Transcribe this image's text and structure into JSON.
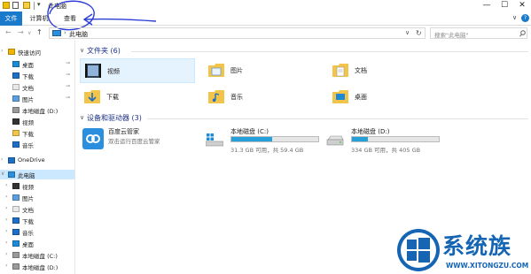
{
  "window": {
    "title": "此电脑",
    "quick_access_dropdown": "▾",
    "minimize": "—",
    "maximize": "☐",
    "close": "✕"
  },
  "ribbon": {
    "tabs": [
      "文件",
      "计算机",
      "查看"
    ],
    "expand": "∨",
    "help": "?"
  },
  "navigation": {
    "back": "←",
    "forward": "→",
    "recent": "∨",
    "up": "↑",
    "separator": "›",
    "address": "此电脑",
    "address_dropdown": "∨",
    "refresh": "↻",
    "search_placeholder": "搜索\"此电脑\"",
    "search_icon": "search-icon"
  },
  "sidebar": {
    "items": [
      {
        "label": "快速访问",
        "icon": "star-icon",
        "chevron": "›",
        "pinned": false
      },
      {
        "label": "桌面",
        "icon": "desktop-icon",
        "chevron": "",
        "pinned": true
      },
      {
        "label": "下载",
        "icon": "download-icon",
        "chevron": "",
        "pinned": true
      },
      {
        "label": "文档",
        "icon": "document-icon",
        "chevron": "",
        "pinned": true
      },
      {
        "label": "图片",
        "icon": "pictures-icon",
        "chevron": "",
        "pinned": true
      },
      {
        "label": "本地磁盘 (D:)",
        "icon": "drive-icon",
        "chevron": "",
        "pinned": false
      },
      {
        "label": "视频",
        "icon": "video-icon",
        "chevron": "",
        "pinned": false
      },
      {
        "label": "下载",
        "icon": "folder-icon",
        "chevron": "",
        "pinned": false
      },
      {
        "label": "音乐",
        "icon": "music-icon",
        "chevron": "",
        "pinned": false
      },
      {
        "label": "OneDrive",
        "icon": "onedrive-icon",
        "chevron": "›",
        "pinned": false
      },
      {
        "label": "此电脑",
        "icon": "computer-icon",
        "chevron": "∨",
        "pinned": false
      },
      {
        "label": "视频",
        "icon": "video-icon",
        "chevron": "›",
        "pinned": false
      },
      {
        "label": "图片",
        "icon": "pictures-icon",
        "chevron": "›",
        "pinned": false
      },
      {
        "label": "文档",
        "icon": "document-icon",
        "chevron": "›",
        "pinned": false
      },
      {
        "label": "下载",
        "icon": "download-icon",
        "chevron": "›",
        "pinned": false
      },
      {
        "label": "音乐",
        "icon": "music-icon",
        "chevron": "›",
        "pinned": false
      },
      {
        "label": "桌面",
        "icon": "desktop-icon",
        "chevron": "›",
        "pinned": false
      },
      {
        "label": "本地磁盘 (C:)",
        "icon": "drive-icon",
        "chevron": "›",
        "pinned": false
      },
      {
        "label": "本地磁盘 (D:)",
        "icon": "drive-icon",
        "chevron": "›",
        "pinned": false
      }
    ],
    "pin_glyph": "⊸"
  },
  "folders": {
    "heading": "文件夹 (6)",
    "chevron": "∨",
    "items": [
      "视频",
      "图片",
      "文档",
      "下载",
      "音乐",
      "桌面"
    ]
  },
  "devices": {
    "heading": "设备和驱动器 (3)",
    "chevron": "∨",
    "app": {
      "name": "百度云管家",
      "subtitle": "双击运行百度云管家"
    },
    "drives": [
      {
        "name": "本地磁盘 (C:)",
        "space": "31.3 GB 可用，共 59.4 GB",
        "used_fraction": 0.47
      },
      {
        "name": "本地磁盘 (D:)",
        "space": "334 GB 可用，共 405 GB",
        "used_fraction": 0.18
      }
    ]
  },
  "watermark": {
    "text": "系统族",
    "url": "WWW.XITONGZU.COM"
  },
  "colors": {
    "accent": "#1979ca",
    "selection": "#cce8ff",
    "drive_bar": "#26a0da",
    "heading": "#1e3287",
    "annotation": "#2b3bd6"
  }
}
